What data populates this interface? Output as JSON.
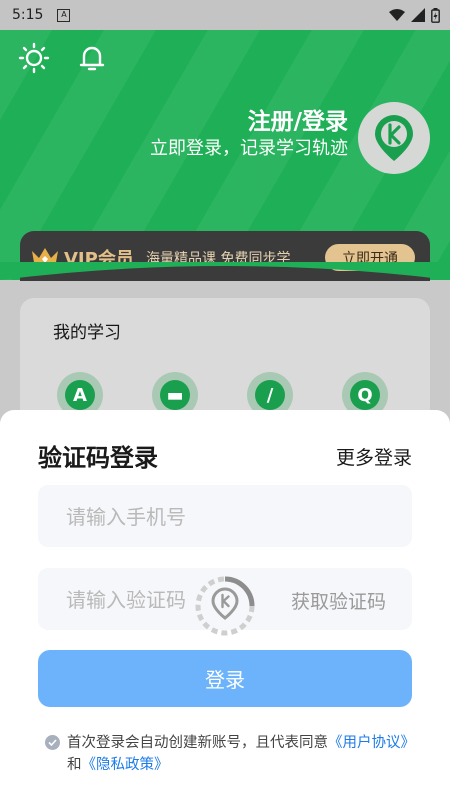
{
  "status_bar": {
    "time": "5:15",
    "badge": "A"
  },
  "header": {
    "title": "注册/登录",
    "subtitle": "立即登录，记录学习轨迹",
    "avatar_letter": "k"
  },
  "vip": {
    "label": "VIP会员",
    "description": "海量精品课 免费同步学",
    "button": "立即开通"
  },
  "study": {
    "title": "我的学习",
    "icons": [
      {
        "letter": "A",
        "icon": "a-icon"
      },
      {
        "letter": "▬",
        "icon": "card-icon"
      },
      {
        "letter": "/",
        "icon": "pen-icon"
      },
      {
        "letter": "Q",
        "icon": "q-icon"
      }
    ]
  },
  "login_sheet": {
    "title": "验证码登录",
    "more_login": "更多登录",
    "phone_placeholder": "请输入手机号",
    "code_placeholder": "请输入验证码",
    "get_code": "获取验证码",
    "login_button": "登录",
    "agreement_prefix": "首次登录会自动创建新账号，且代表同意",
    "user_agreement": "《用户协议》",
    "and": "和",
    "privacy_policy": "《隐私政策》"
  },
  "colors": {
    "brand_green": "#1fb057",
    "login_blue": "#6cb3fc",
    "vip_gold": "#e3c38f"
  }
}
